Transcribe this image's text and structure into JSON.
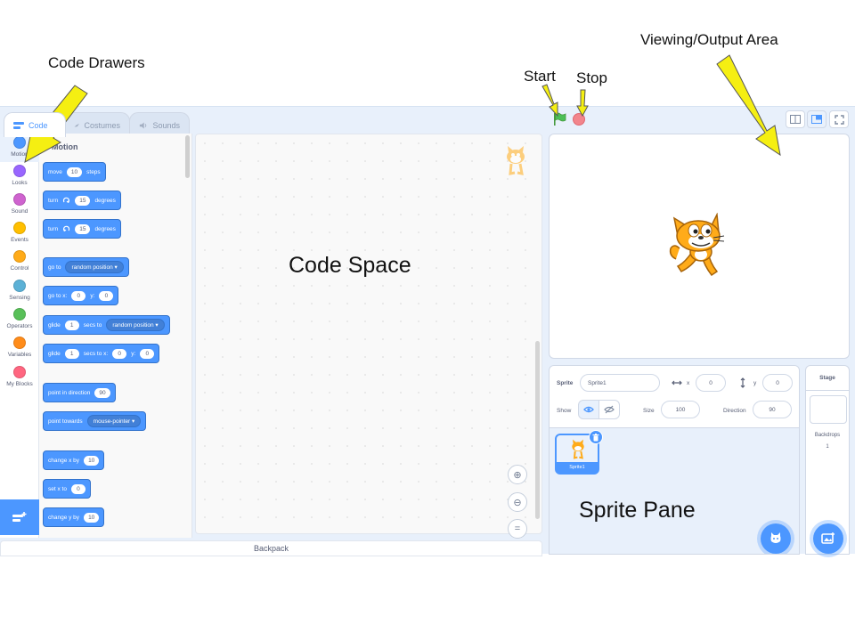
{
  "annotations": {
    "code_drawers": "Code Drawers",
    "viewing_output": "Viewing/Output Area",
    "start": "Start",
    "stop": "Stop",
    "code_space": "Code Space",
    "sprite_pane": "Sprite Pane"
  },
  "colors": {
    "arrow_fill": "#f5ef12",
    "motion_blue": "#4c97ff",
    "editor_bg": "#e8f0fb"
  },
  "tabs": [
    {
      "label": "Code",
      "icon": "code-icon"
    },
    {
      "label": "Costumes",
      "icon": "brush-icon"
    },
    {
      "label": "Sounds",
      "icon": "speaker-icon"
    }
  ],
  "categories": [
    {
      "label": "Motion",
      "color": "#4c97ff"
    },
    {
      "label": "Looks",
      "color": "#9966ff"
    },
    {
      "label": "Sound",
      "color": "#cf63cf"
    },
    {
      "label": "Events",
      "color": "#ffbf00"
    },
    {
      "label": "Control",
      "color": "#ffab19"
    },
    {
      "label": "Sensing",
      "color": "#5cb1d6"
    },
    {
      "label": "Operators",
      "color": "#59c059"
    },
    {
      "label": "Variables",
      "color": "#ff8c1a"
    },
    {
      "label": "My Blocks",
      "color": "#ff6680"
    }
  ],
  "palette": {
    "title": "Motion",
    "blocks": {
      "move": {
        "pre": "move",
        "val": "10",
        "post": "steps"
      },
      "turn_right": {
        "pre": "turn",
        "val": "15",
        "post": "degrees"
      },
      "turn_left": {
        "pre": "turn",
        "val": "15",
        "post": "degrees"
      },
      "go_to": {
        "pre": "go to",
        "opt": "random position"
      },
      "go_to_xy": {
        "pre": "go to x:",
        "x": "0",
        "mid": "y:",
        "y": "0"
      },
      "glide_to": {
        "pre": "glide",
        "val": "1",
        "mid": "secs to",
        "opt": "random position"
      },
      "glide_xy": {
        "pre": "glide",
        "val": "1",
        "mid": "secs to x:",
        "x": "0",
        "mid2": "y:",
        "y": "0"
      },
      "point_dir": {
        "pre": "point in direction",
        "val": "90"
      },
      "point_towards": {
        "pre": "point towards",
        "opt": "mouse-pointer"
      },
      "change_x": {
        "pre": "change x by",
        "val": "10"
      },
      "set_x": {
        "pre": "set x to",
        "val": "0"
      },
      "change_y": {
        "pre": "change y by",
        "val": "10"
      }
    }
  },
  "backpack": "Backpack",
  "sprite_info": {
    "sprite_label": "Sprite",
    "sprite_name": "Sprite1",
    "x_label": "x",
    "x_value": "0",
    "y_label": "y",
    "y_value": "0",
    "show_label": "Show",
    "size_label": "Size",
    "size_value": "100",
    "direction_label": "Direction",
    "direction_value": "90"
  },
  "sprite_list": [
    {
      "name": "Sprite1"
    }
  ],
  "stage_panel": {
    "title": "Stage",
    "backdrops_label": "Backdrops",
    "backdrops_count": "1"
  }
}
